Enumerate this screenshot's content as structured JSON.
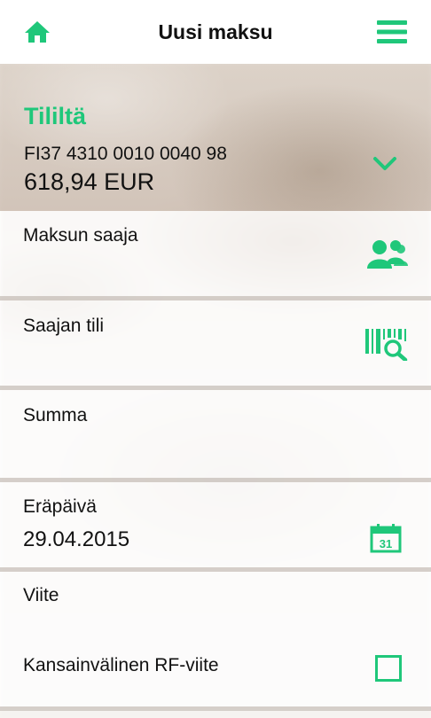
{
  "header": {
    "title": "Uusi maksu",
    "home_icon": "home-icon",
    "menu_icon": "hamburger-menu-icon"
  },
  "account": {
    "label": "Tililtä",
    "iban": "FI37 4310 0010 0040 98",
    "balance": "618,94 EUR",
    "expand_icon": "chevron-down-icon"
  },
  "fields": {
    "recipient": {
      "label": "Maksun saaja",
      "icon": "contacts-icon"
    },
    "recipient_account": {
      "label": "Saajan tili",
      "icon": "barcode-scan-icon"
    },
    "amount": {
      "label": "Summa"
    },
    "due_date": {
      "label": "Eräpäivä",
      "value": "29.04.2015",
      "icon": "calendar-icon",
      "calendar_day": "31"
    },
    "reference": {
      "label": "Viite"
    },
    "rf_reference": {
      "label": "Kansainvälinen RF-viite",
      "checked": false
    }
  },
  "colors": {
    "accent": "#1fc77a",
    "text": "#111111"
  }
}
